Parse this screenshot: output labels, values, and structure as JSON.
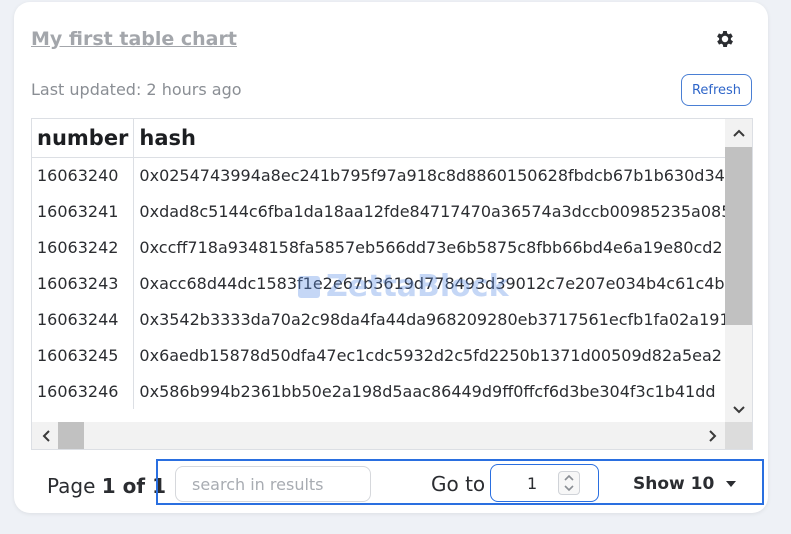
{
  "card": {
    "title": "My first table chart",
    "last_updated": "Last updated: 2 hours ago",
    "refresh_label": "Refresh",
    "watermark": "ZettaBlock"
  },
  "table": {
    "columns": [
      "number",
      "hash"
    ],
    "rows": [
      [
        "16063240",
        "0x0254743994a8ec241b795f97a918c8d8860150628fbdcb67b1b630d34"
      ],
      [
        "16063241",
        "0xdad8c5144c6fba1da18aa12fde84717470a36574a3dccb00985235a085"
      ],
      [
        "16063242",
        "0xccff718a9348158fa5857eb566dd73e6b5875c8fbb66bd4e6a19e80cd2"
      ],
      [
        "16063243",
        "0xacc68d44dc1583f1e2e67b3619d778493d39012c7e207e034b4c61c4b"
      ],
      [
        "16063244",
        "0x3542b3333da70a2c98da4fa44da968209280eb3717561ecfb1fa02a191"
      ],
      [
        "16063245",
        "0x6aedb15878d50dfa47ec1cdc5932d2c5fd2250b1371d00509d82a5ea2"
      ],
      [
        "16063246",
        "0x586b994b2361bb50e2a198d5aac86449d9ff0ffcf6d3be304f3c1b41dd"
      ]
    ]
  },
  "pagination": {
    "page_prefix": "Page ",
    "page_current": "1",
    "page_of": " of 1",
    "search_placeholder": "search in results",
    "goto_label": "Go to",
    "goto_value": "1",
    "show_label": "Show 10"
  },
  "colors": {
    "accent": "#2a6fe0",
    "title": "#a3a6ab"
  }
}
